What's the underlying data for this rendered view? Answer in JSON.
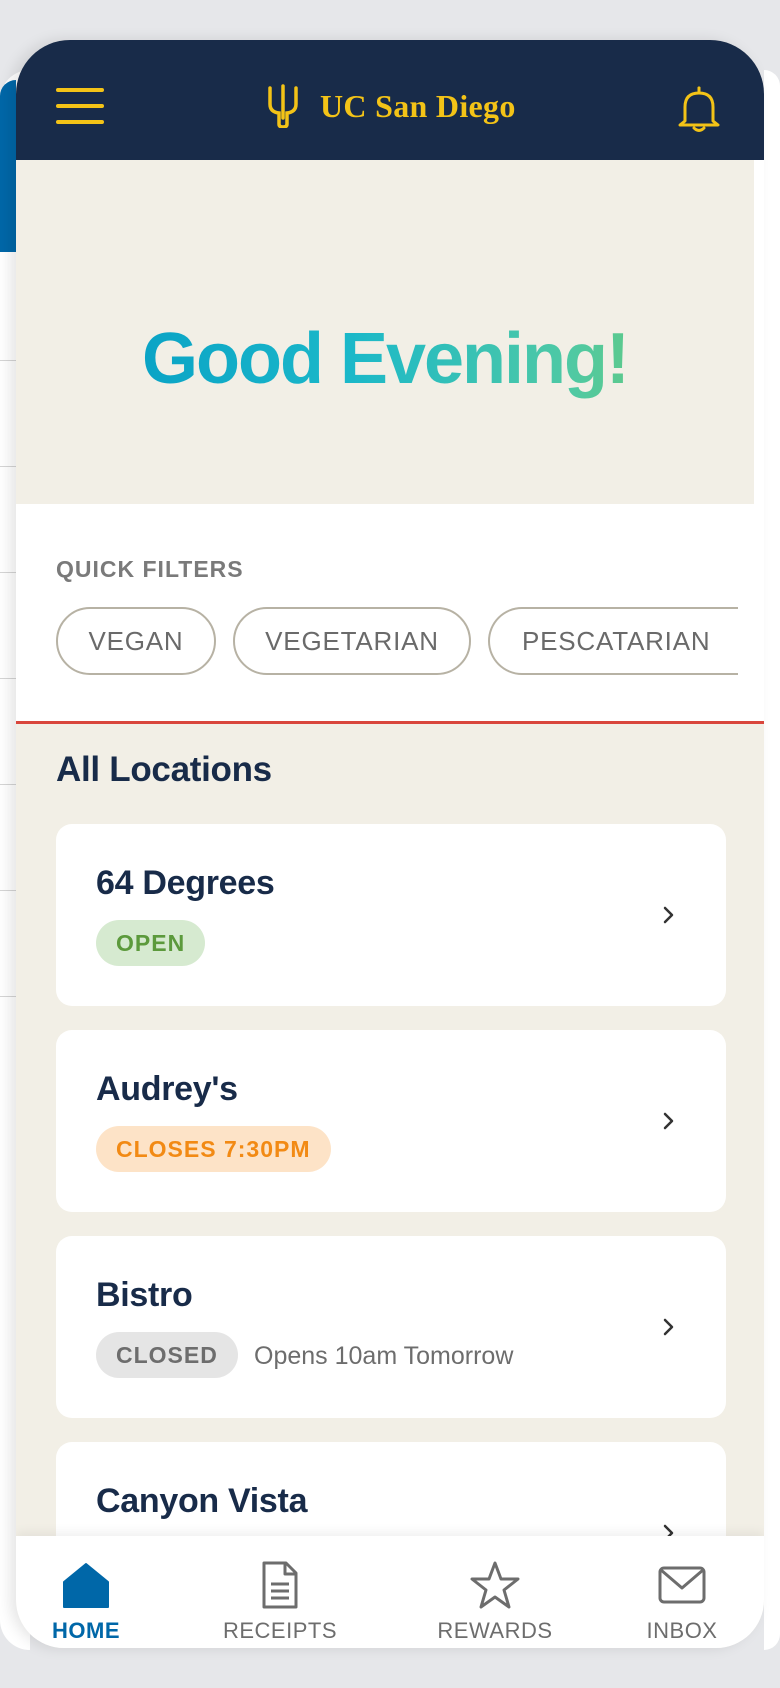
{
  "header": {
    "brand": "UC San Diego",
    "menu_icon": "hamburger-menu-icon",
    "logo_icon": "trident-icon",
    "notification_icon": "bell-icon",
    "colors": {
      "navy": "#182b49",
      "gold": "#f3c317"
    }
  },
  "greeting": "Good Evening!",
  "quick_filters": {
    "title": "QUICK FILTERS",
    "chips": [
      "VEGAN",
      "VEGETARIAN",
      "PESCATARIAN"
    ]
  },
  "locations": {
    "title": "All Locations",
    "items": [
      {
        "name": "64 Degrees",
        "status": "OPEN",
        "status_color": "#5c9a3c",
        "note": ""
      },
      {
        "name": "Audrey's",
        "status": "CLOSES 7:30PM",
        "status_color": "#f28a14",
        "note": ""
      },
      {
        "name": "Bistro",
        "status": "CLOSED",
        "status_color": "#6d6d6d",
        "note": "Opens 10am Tomorrow"
      },
      {
        "name": "Canyon Vista",
        "status": "",
        "status_color": "",
        "note": ""
      }
    ]
  },
  "bottom_nav": {
    "items": [
      {
        "label": "HOME",
        "icon": "home-icon",
        "active": true
      },
      {
        "label": "RECEIPTS",
        "icon": "receipt-icon",
        "active": false
      },
      {
        "label": "REWARDS",
        "icon": "star-icon",
        "active": false
      },
      {
        "label": "INBOX",
        "icon": "mail-icon",
        "active": false
      }
    ],
    "active_color": "#0067a8"
  }
}
